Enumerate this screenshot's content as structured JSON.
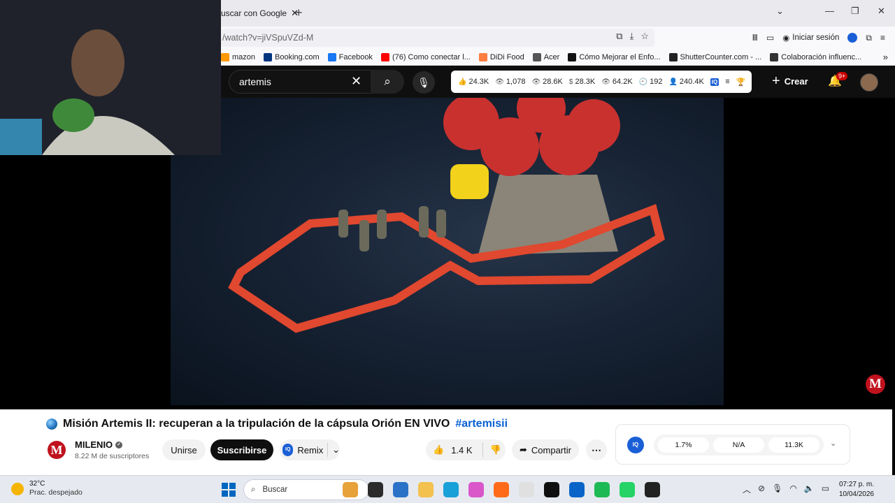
{
  "browser": {
    "tab_title": "uscar con Google",
    "url": "/watch?v=jiVSpuVZd-M",
    "signin_label": "Iniciar sesión",
    "bookmarks": [
      {
        "label": "mazon",
        "color": "#ff9900"
      },
      {
        "label": "Booking.com",
        "color": "#003580"
      },
      {
        "label": "Facebook",
        "color": "#1877f2"
      },
      {
        "label": "(76) Como conectar l...",
        "color": "#ff0000"
      },
      {
        "label": "DiDi Food",
        "color": "#ff7d41"
      },
      {
        "label": "Acer",
        "color": "#555555"
      },
      {
        "label": "Cómo Mejorar el Enfo...",
        "color": "#111111"
      },
      {
        "label": "ShutterCounter.com - ...",
        "color": "#222222"
      },
      {
        "label": "Colaboración influenc...",
        "color": "#333333"
      }
    ]
  },
  "youtube": {
    "search_value": "artemis",
    "stats": [
      {
        "icon": "thumb-icon",
        "glyph": "👍",
        "value": "24.3K"
      },
      {
        "icon": "eye-icon",
        "glyph": "👁",
        "value": "1,078"
      },
      {
        "icon": "eye-icon",
        "glyph": "👁",
        "value": "28.6K"
      },
      {
        "icon": "dollar-icon",
        "glyph": "$",
        "value": "28.3K"
      },
      {
        "icon": "eye-icon",
        "glyph": "👁",
        "value": "64.2K"
      },
      {
        "icon": "clock-icon",
        "glyph": "🕘",
        "value": "192"
      },
      {
        "icon": "person-icon",
        "glyph": "👤",
        "value": "240.4K"
      }
    ],
    "iq_label": "IQ",
    "create_label": "Crear",
    "notifications_badge": "9+"
  },
  "video": {
    "watermark": "M",
    "title": "Misión Artemis II: recuperan a la tripulación de la cápsula Orión EN VIVO",
    "hashtag": "#artemisii",
    "channel_initial": "M",
    "channel_name": "MILENIO",
    "subscribers": "8.22 M de suscriptores",
    "join_label": "Unirse",
    "subscribe_label": "Suscribirse",
    "remix_label": "Remix",
    "likes": "1.4 K",
    "share_label": "Compartir"
  },
  "metrics": {
    "iq_label": "IQ",
    "values": [
      "1.7%",
      "N/A",
      "11.3K"
    ]
  },
  "taskbar": {
    "temperature": "32°C",
    "weather_desc": "Prac. despejado",
    "search_placeholder": "Buscar",
    "time": "07:27 p. m.",
    "date": "10/04/2026",
    "apps": [
      {
        "name": "game-app-icon",
        "color": "#e8a23a"
      },
      {
        "name": "file-explorer-dark-icon",
        "color": "#2b2b2b"
      },
      {
        "name": "store-icon",
        "color": "#2a72c7"
      },
      {
        "name": "folder-icon",
        "color": "#f2c14e"
      },
      {
        "name": "edge-icon",
        "color": "#1aa0d8"
      },
      {
        "name": "copilot-icon",
        "color": "#d957c9"
      },
      {
        "name": "firefox-icon",
        "color": "#ff6a1a"
      },
      {
        "name": "amazon-icon",
        "color": "#e0e0e0"
      },
      {
        "name": "dropbox-icon",
        "color": "#0f0f0f"
      },
      {
        "name": "outlook-icon",
        "color": "#0a64c8"
      },
      {
        "name": "spotify-icon",
        "color": "#1db954"
      },
      {
        "name": "whatsapp-icon",
        "color": "#25d366"
      },
      {
        "name": "obs-icon",
        "color": "#222222"
      }
    ]
  }
}
